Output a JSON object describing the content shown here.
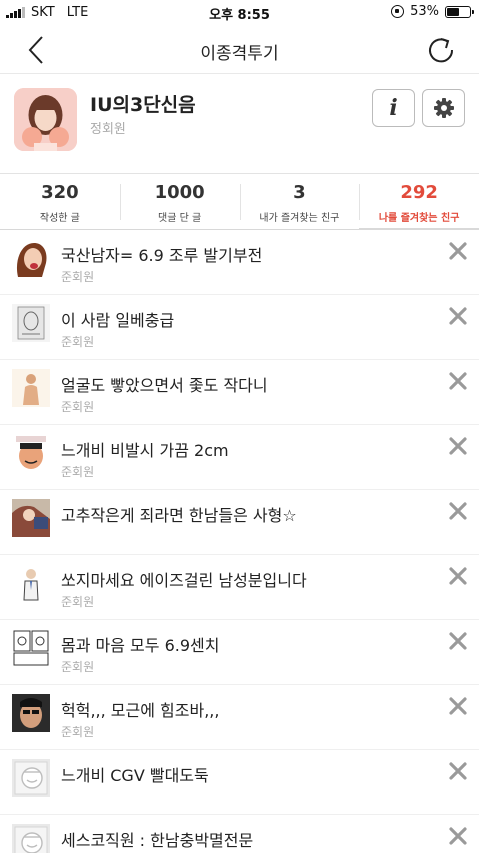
{
  "status_bar": {
    "carrier": "SKT",
    "network": "LTE",
    "time": "오후 8:55",
    "battery": "53%",
    "battery_level": 0.53
  },
  "nav": {
    "title": "이종격투기",
    "back_icon": "chevron-left-icon",
    "refresh_icon": "refresh-icon"
  },
  "profile": {
    "name": "IU의3단신음",
    "grade": "정회원",
    "info_button_glyph": "i",
    "settings_icon": "gear-icon"
  },
  "stats": [
    {
      "value": "320",
      "label": "작성한 글"
    },
    {
      "value": "1000",
      "label": "댓글 단 글"
    },
    {
      "value": "3",
      "label": "내가 즐겨찾는 친구"
    },
    {
      "value": "292",
      "label": "나를 즐겨찾는 친구",
      "active": true
    }
  ],
  "accent_color": "#e24b3b",
  "friends": [
    {
      "name": "국산남자= 6.9 조루 발기부전",
      "grade": "준회원"
    },
    {
      "name": "이 사람 일베충급",
      "grade": "준회원"
    },
    {
      "name": "얼굴도 빻았으면서 좇도 작다니",
      "grade": "준회원"
    },
    {
      "name": "느개비 비발시 가끔 2cm",
      "grade": "준회원"
    },
    {
      "name": "고추작은게 죄라면 한남들은 사형☆",
      "grade": ""
    },
    {
      "name": "쏘지마세요 에이즈걸린 남성분입니다",
      "grade": "준회원"
    },
    {
      "name": "몸과 마음 모두 6.9센치",
      "grade": "준회원"
    },
    {
      "name": "헉헉,,, 모근에 힘조바,,,",
      "grade": "준회원"
    },
    {
      "name": "느개비 CGV 빨대도둑",
      "grade": ""
    },
    {
      "name": "세스코직원 : 한남충박멸전문",
      "grade": ""
    }
  ]
}
